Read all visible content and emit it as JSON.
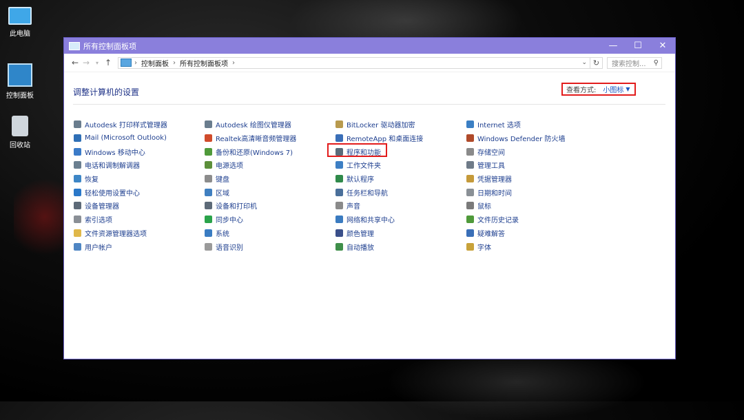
{
  "desktop": {
    "icons": [
      {
        "label": "此电脑",
        "icon": "computer-icon"
      },
      {
        "label": "控制面板",
        "icon": "control-panel-icon"
      },
      {
        "label": "回收站",
        "icon": "recycle-bin-icon"
      }
    ]
  },
  "window": {
    "title": "所有控制面板项",
    "breadcrumb": [
      "控制面板",
      "所有控制面板项"
    ],
    "search_placeholder": "搜索控制...",
    "heading": "调整计算机的设置",
    "view_by_label": "查看方式:",
    "view_by_value": "小图标",
    "highlight_color": "#e21b1b",
    "title_bar_color": "#8a7fdc"
  },
  "items": {
    "col1": [
      {
        "label": "Autodesk 打印样式管理器",
        "color": "#6a7d8e"
      },
      {
        "label": "Mail (Microsoft Outlook)",
        "color": "#2f6fb6"
      },
      {
        "label": "Windows 移动中心",
        "color": "#3b7bc8"
      },
      {
        "label": "电话和调制解调器",
        "color": "#6b7f90"
      },
      {
        "label": "恢复",
        "color": "#3d86c6"
      },
      {
        "label": "轻松使用设置中心",
        "color": "#2a78c9"
      },
      {
        "label": "设备管理器",
        "color": "#5d6a78"
      },
      {
        "label": "索引选项",
        "color": "#8a8f96"
      },
      {
        "label": "文件资源管理器选项",
        "color": "#e0b84a"
      },
      {
        "label": "用户帐户",
        "color": "#4f86c4"
      }
    ],
    "col2": [
      {
        "label": "Autodesk 绘图仪管理器",
        "color": "#6a7d8e"
      },
      {
        "label": "Realtek高清晰音频管理器",
        "color": "#d04b2b"
      },
      {
        "label": "备份和还原(Windows 7)",
        "color": "#4f9a3a"
      },
      {
        "label": "电源选项",
        "color": "#5c8f3a"
      },
      {
        "label": "键盘",
        "color": "#8c8c8c"
      },
      {
        "label": "区域",
        "color": "#3f7fc0"
      },
      {
        "label": "设备和打印机",
        "color": "#5d6a78"
      },
      {
        "label": "同步中心",
        "color": "#2aa34a"
      },
      {
        "label": "系统",
        "color": "#3a7cc2"
      },
      {
        "label": "语音识别",
        "color": "#9a9a9a"
      }
    ],
    "col3": [
      {
        "label": "BitLocker 驱动器加密",
        "color": "#b89a4e"
      },
      {
        "label": "RemoteApp 和桌面连接",
        "color": "#3a6fb8"
      },
      {
        "label": "程序和功能",
        "color": "#5a6b7a",
        "highlighted": true
      },
      {
        "label": "工作文件夹",
        "color": "#3d7fc4"
      },
      {
        "label": "默认程序",
        "color": "#2f8a4a"
      },
      {
        "label": "任务栏和导航",
        "color": "#4a6f9a"
      },
      {
        "label": "声音",
        "color": "#8a8a8a"
      },
      {
        "label": "网络和共享中心",
        "color": "#3a7bc0"
      },
      {
        "label": "颜色管理",
        "color": "#3a4f8a"
      },
      {
        "label": "自动播放",
        "color": "#3f8f4a"
      }
    ],
    "col4": [
      {
        "label": "Internet 选项",
        "color": "#3b7fc4"
      },
      {
        "label": "Windows Defender 防火墙",
        "color": "#b04a2a"
      },
      {
        "label": "存储空间",
        "color": "#8a8a8a"
      },
      {
        "label": "管理工具",
        "color": "#6f7b88"
      },
      {
        "label": "凭据管理器",
        "color": "#c59a3a"
      },
      {
        "label": "日期和时间",
        "color": "#8a9096"
      },
      {
        "label": "鼠标",
        "color": "#7a7a7a"
      },
      {
        "label": "文件历史记录",
        "color": "#4f9a3a"
      },
      {
        "label": "疑难解答",
        "color": "#3a6fb8"
      },
      {
        "label": "字体",
        "color": "#c8a23a"
      }
    ]
  }
}
